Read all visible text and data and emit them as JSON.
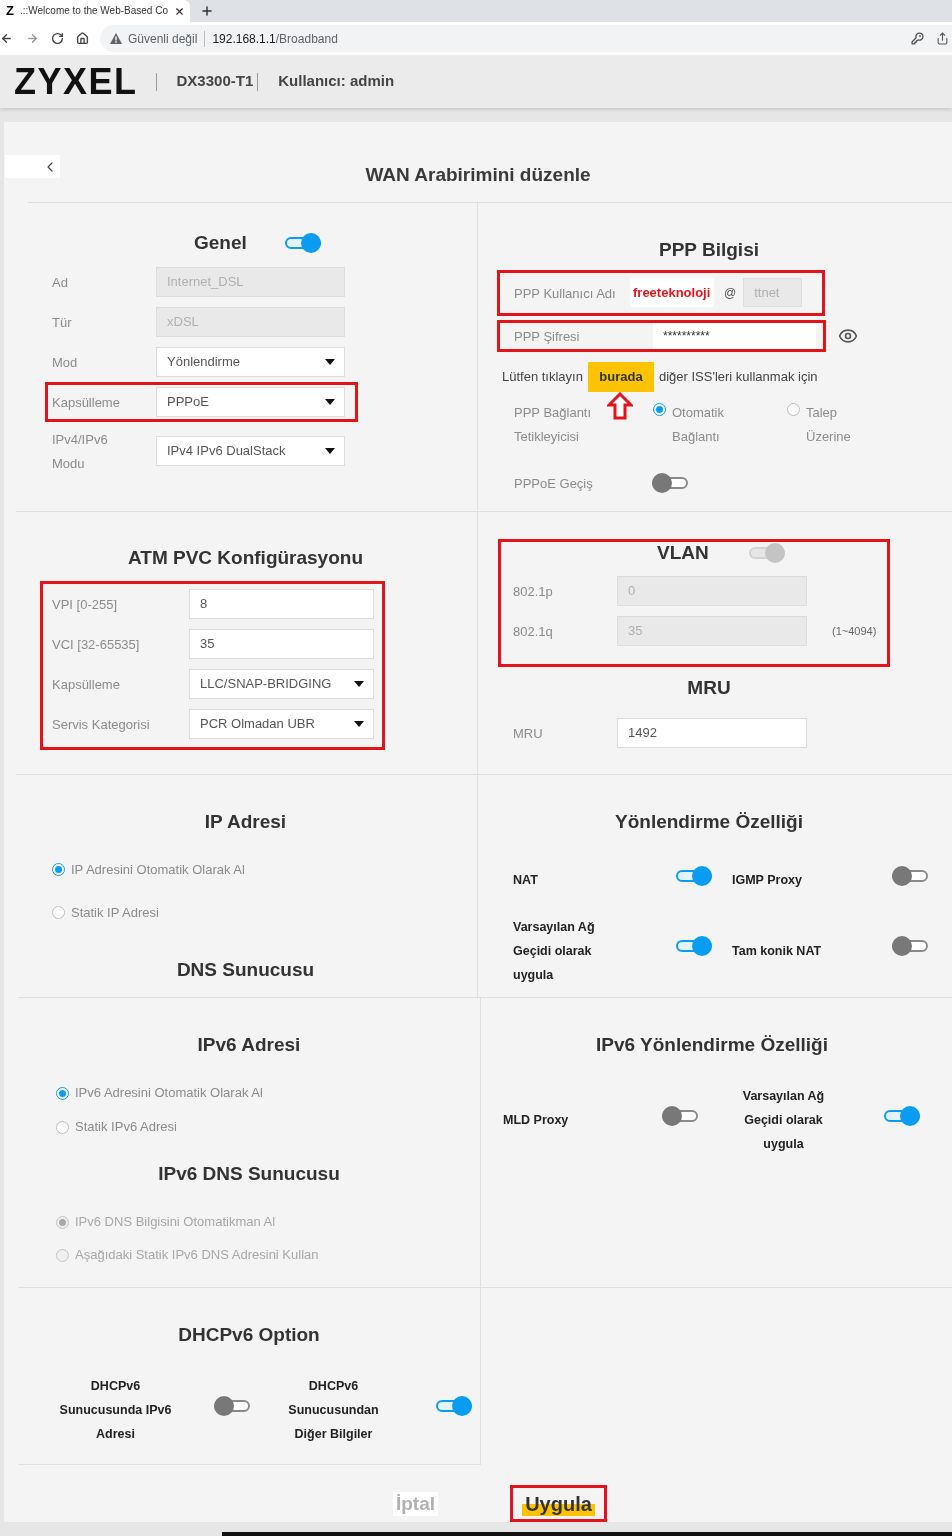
{
  "browser": {
    "favicon": "Z",
    "tab_title": ".::Welcome to the Web-Based Co",
    "security": "Güvenli değil",
    "url_host": "192.168.1.1",
    "url_path": "/Broadband"
  },
  "header": {
    "logo": "ZYXEL",
    "model": "DX3300-T1",
    "user": "Kullanıcı: admin"
  },
  "page_title": "WAN Arabirimini düzenle",
  "general": {
    "title": "Genel",
    "on": true,
    "fields": [
      {
        "label": "Ad",
        "kind": "text",
        "value": "Internet_DSL",
        "disabled": true,
        "annotated": false
      },
      {
        "label": "Tür",
        "kind": "text",
        "value": "xDSL",
        "disabled": true,
        "annotated": false
      },
      {
        "label": "Mod",
        "kind": "select",
        "value": "Yönlendirme",
        "disabled": false,
        "annotated": false
      },
      {
        "label": "Kapsülleme",
        "kind": "select",
        "value": "PPPoE",
        "disabled": false,
        "annotated": true
      },
      {
        "label": "IPv4/IPv6 Modu",
        "kind": "select",
        "value": "IPv4 IPv6 DualStack",
        "disabled": false,
        "annotated": false
      }
    ]
  },
  "ppp": {
    "title": "PPP Bilgisi",
    "username": {
      "label": "PPP Kullanıcı Adı",
      "value": "freeteknoloji",
      "separator": "@",
      "domain": {
        "value": "ttnet",
        "disabled": true
      },
      "annotated": true
    },
    "password": {
      "label": "PPP Şifresi",
      "value": "**********",
      "annotated": true
    },
    "hint": {
      "before": "Lütfen tıklayın",
      "link": "burada",
      "after": "diğer ISS'leri kullanmak için",
      "annotated": true
    },
    "trigger": {
      "label": "PPP Bağlantı Tetikleyicisi",
      "options": [
        {
          "label": "Otomatik Bağlantı",
          "selected": true
        },
        {
          "label": "Talep Üzerine",
          "selected": false
        }
      ]
    },
    "passthrough": {
      "label": "PPPoE Geçiş",
      "on": false
    }
  },
  "atm": {
    "title": "ATM PVC Konfigürasyonu",
    "annotated": true,
    "fields": [
      {
        "label": "VPI [0-255]",
        "kind": "text",
        "value": "8"
      },
      {
        "label": "VCI [32-65535]",
        "kind": "text",
        "value": "35"
      },
      {
        "label": "Kapsülleme",
        "kind": "select",
        "value": "LLC/SNAP-BRIDGING"
      },
      {
        "label": "Servis Kategorisi",
        "kind": "select",
        "value": "PCR Olmadan UBR"
      }
    ]
  },
  "vlan": {
    "title": "VLAN",
    "on": true,
    "disabled": true,
    "annotated": true,
    "fields": [
      {
        "label": "802.1p",
        "kind": "text",
        "value": "0",
        "disabled": true
      },
      {
        "label": "802.1q",
        "kind": "text",
        "value": "35",
        "disabled": true,
        "hint": "(1~4094)"
      }
    ]
  },
  "mru": {
    "title": "MRU",
    "label": "MRU",
    "kind": "text",
    "value": "1492"
  },
  "ip": {
    "title": "IP Adresi",
    "options": [
      {
        "label": "IP Adresini Otomatik Olarak Al",
        "selected": true
      },
      {
        "label": "Statik IP Adresi",
        "selected": false
      }
    ],
    "dns_title": "DNS Sunucusu"
  },
  "routing": {
    "title": "Yönlendirme Özelliği",
    "switches": [
      {
        "label": "NAT",
        "on": true
      },
      {
        "label": "IGMP Proxy",
        "on": false
      },
      {
        "label": "Varsayılan Ağ Geçidi olarak uygula",
        "on": true
      },
      {
        "label": "Tam konik NAT",
        "on": false
      }
    ]
  },
  "ipv6": {
    "title": "IPv6 Adresi",
    "options": [
      {
        "label": "IPv6 Adresini Otomatik Olarak Al",
        "selected": true
      },
      {
        "label": "Statik IPv6 Adresi",
        "selected": false
      }
    ],
    "dns_title": "IPv6 DNS Sunucusu",
    "dns_options": [
      {
        "label": "IPv6 DNS Bilgisini Otomatikman Al",
        "selected": true,
        "disabled": true
      },
      {
        "label": "Aşağıdaki Statik IPv6 DNS Adresini Kullan",
        "selected": false,
        "disabled": true
      }
    ]
  },
  "ipv6_routing": {
    "title": "IPv6 Yönlendirme Özelliği",
    "switches": [
      {
        "label": "MLD Proxy",
        "on": false
      },
      {
        "label": "Varsayılan Ağ Geçidi olarak uygula",
        "on": true
      }
    ]
  },
  "dhcpv6": {
    "title": "DHCPv6 Option",
    "switches": [
      {
        "label": "DHCPv6 Sunucusunda IPv6 Adresi",
        "on": false
      },
      {
        "label": "DHCPv6 Sunucusundan Diğer Bilgiler",
        "on": true
      }
    ]
  },
  "buttons": [
    {
      "label": "İptal",
      "kind": "secondary",
      "annotated": false
    },
    {
      "label": "Uygula",
      "kind": "primary",
      "annotated": true
    }
  ]
}
